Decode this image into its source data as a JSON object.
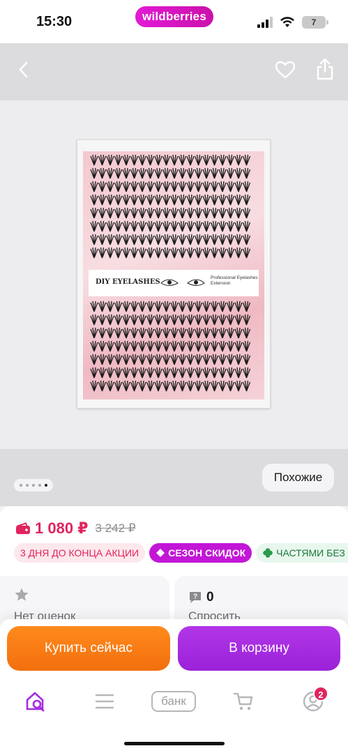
{
  "status_bar": {
    "time": "15:30",
    "brand_pill": "wildberries",
    "battery": "7",
    "icons": [
      "signal-icon",
      "wifi-icon",
      "battery-icon"
    ]
  },
  "gallery": {
    "nav_icons": [
      "back-icon",
      "heart-icon",
      "share-icon"
    ],
    "product_label": {
      "title": "DIY EYELASHES",
      "subtitle": "Professional Eyelashes Extension"
    },
    "dots": {
      "count": 5,
      "active_index": 4
    },
    "similar_label": "Похожие"
  },
  "price": {
    "current": "1 080 ₽",
    "old": "3 242 ₽",
    "color": "#e0245e"
  },
  "badges": [
    {
      "text": "3 ДНЯ ДО КОНЦА АКЦИИ",
      "style": "red"
    },
    {
      "text": "СЕЗОН СКИДОК",
      "style": "purple",
      "icon": "tag-icon"
    },
    {
      "text": "ЧАСТЯМИ БЕЗ П",
      "style": "green",
      "icon": "clover-icon"
    }
  ],
  "cards": {
    "rating_text": "Нет оценок",
    "questions_count": "0",
    "questions_text": "Спросить"
  },
  "actions": {
    "buy_now": "Купить сейчас",
    "add_to_cart": "В корзину",
    "buy_color": "#f2780f",
    "cart_color": "#a52bdf"
  },
  "tab_bar": {
    "items": [
      "home-search-icon",
      "menu-icon",
      "bank",
      "cart-icon",
      "profile-icon"
    ],
    "bank_label": "банк",
    "profile_badge": "2",
    "active_color": "#a52bdf"
  }
}
